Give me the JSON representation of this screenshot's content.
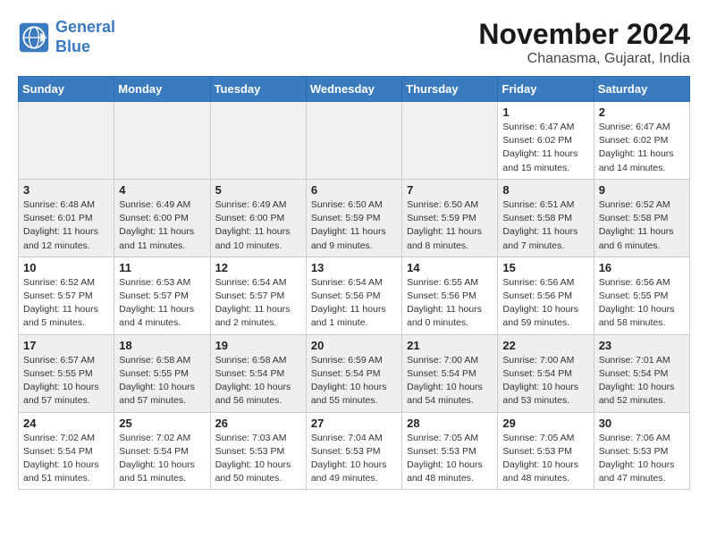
{
  "logo": {
    "line1": "General",
    "line2": "Blue"
  },
  "title": "November 2024",
  "location": "Chanasma, Gujarat, India",
  "days_of_week": [
    "Sunday",
    "Monday",
    "Tuesday",
    "Wednesday",
    "Thursday",
    "Friday",
    "Saturday"
  ],
  "weeks": [
    [
      {
        "day": "",
        "info": ""
      },
      {
        "day": "",
        "info": ""
      },
      {
        "day": "",
        "info": ""
      },
      {
        "day": "",
        "info": ""
      },
      {
        "day": "",
        "info": ""
      },
      {
        "day": "1",
        "info": "Sunrise: 6:47 AM\nSunset: 6:02 PM\nDaylight: 11 hours and 15 minutes."
      },
      {
        "day": "2",
        "info": "Sunrise: 6:47 AM\nSunset: 6:02 PM\nDaylight: 11 hours and 14 minutes."
      }
    ],
    [
      {
        "day": "3",
        "info": "Sunrise: 6:48 AM\nSunset: 6:01 PM\nDaylight: 11 hours and 12 minutes."
      },
      {
        "day": "4",
        "info": "Sunrise: 6:49 AM\nSunset: 6:00 PM\nDaylight: 11 hours and 11 minutes."
      },
      {
        "day": "5",
        "info": "Sunrise: 6:49 AM\nSunset: 6:00 PM\nDaylight: 11 hours and 10 minutes."
      },
      {
        "day": "6",
        "info": "Sunrise: 6:50 AM\nSunset: 5:59 PM\nDaylight: 11 hours and 9 minutes."
      },
      {
        "day": "7",
        "info": "Sunrise: 6:50 AM\nSunset: 5:59 PM\nDaylight: 11 hours and 8 minutes."
      },
      {
        "day": "8",
        "info": "Sunrise: 6:51 AM\nSunset: 5:58 PM\nDaylight: 11 hours and 7 minutes."
      },
      {
        "day": "9",
        "info": "Sunrise: 6:52 AM\nSunset: 5:58 PM\nDaylight: 11 hours and 6 minutes."
      }
    ],
    [
      {
        "day": "10",
        "info": "Sunrise: 6:52 AM\nSunset: 5:57 PM\nDaylight: 11 hours and 5 minutes."
      },
      {
        "day": "11",
        "info": "Sunrise: 6:53 AM\nSunset: 5:57 PM\nDaylight: 11 hours and 4 minutes."
      },
      {
        "day": "12",
        "info": "Sunrise: 6:54 AM\nSunset: 5:57 PM\nDaylight: 11 hours and 2 minutes."
      },
      {
        "day": "13",
        "info": "Sunrise: 6:54 AM\nSunset: 5:56 PM\nDaylight: 11 hours and 1 minute."
      },
      {
        "day": "14",
        "info": "Sunrise: 6:55 AM\nSunset: 5:56 PM\nDaylight: 11 hours and 0 minutes."
      },
      {
        "day": "15",
        "info": "Sunrise: 6:56 AM\nSunset: 5:56 PM\nDaylight: 10 hours and 59 minutes."
      },
      {
        "day": "16",
        "info": "Sunrise: 6:56 AM\nSunset: 5:55 PM\nDaylight: 10 hours and 58 minutes."
      }
    ],
    [
      {
        "day": "17",
        "info": "Sunrise: 6:57 AM\nSunset: 5:55 PM\nDaylight: 10 hours and 57 minutes."
      },
      {
        "day": "18",
        "info": "Sunrise: 6:58 AM\nSunset: 5:55 PM\nDaylight: 10 hours and 57 minutes."
      },
      {
        "day": "19",
        "info": "Sunrise: 6:58 AM\nSunset: 5:54 PM\nDaylight: 10 hours and 56 minutes."
      },
      {
        "day": "20",
        "info": "Sunrise: 6:59 AM\nSunset: 5:54 PM\nDaylight: 10 hours and 55 minutes."
      },
      {
        "day": "21",
        "info": "Sunrise: 7:00 AM\nSunset: 5:54 PM\nDaylight: 10 hours and 54 minutes."
      },
      {
        "day": "22",
        "info": "Sunrise: 7:00 AM\nSunset: 5:54 PM\nDaylight: 10 hours and 53 minutes."
      },
      {
        "day": "23",
        "info": "Sunrise: 7:01 AM\nSunset: 5:54 PM\nDaylight: 10 hours and 52 minutes."
      }
    ],
    [
      {
        "day": "24",
        "info": "Sunrise: 7:02 AM\nSunset: 5:54 PM\nDaylight: 10 hours and 51 minutes."
      },
      {
        "day": "25",
        "info": "Sunrise: 7:02 AM\nSunset: 5:54 PM\nDaylight: 10 hours and 51 minutes."
      },
      {
        "day": "26",
        "info": "Sunrise: 7:03 AM\nSunset: 5:53 PM\nDaylight: 10 hours and 50 minutes."
      },
      {
        "day": "27",
        "info": "Sunrise: 7:04 AM\nSunset: 5:53 PM\nDaylight: 10 hours and 49 minutes."
      },
      {
        "day": "28",
        "info": "Sunrise: 7:05 AM\nSunset: 5:53 PM\nDaylight: 10 hours and 48 minutes."
      },
      {
        "day": "29",
        "info": "Sunrise: 7:05 AM\nSunset: 5:53 PM\nDaylight: 10 hours and 48 minutes."
      },
      {
        "day": "30",
        "info": "Sunrise: 7:06 AM\nSunset: 5:53 PM\nDaylight: 10 hours and 47 minutes."
      }
    ]
  ]
}
